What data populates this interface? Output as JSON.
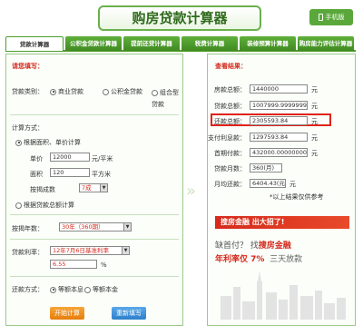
{
  "header": {
    "title": "购房贷款计算器",
    "mobile_label": "手机版"
  },
  "tabs": [
    {
      "label": "贷款计算器",
      "active": true
    },
    {
      "label": "公积金贷款计算器",
      "active": false
    },
    {
      "label": "提前还贷计算器",
      "active": false
    },
    {
      "label": "税费计算器",
      "active": false
    },
    {
      "label": "装修预算计算器",
      "active": false
    },
    {
      "label": "购房能力评估计算器",
      "active": false
    }
  ],
  "form": {
    "section_title": "请您填写：",
    "loan_type_label": "贷款类别：",
    "loan_types": [
      "商业贷款",
      "公积金贷款",
      "组合型贷款"
    ],
    "calc_method_label": "计算方式：",
    "method_by_price": "根据面积、单价计算",
    "unit_price_label": "单价",
    "unit_price_value": "12000",
    "unit_price_unit": "元/平米",
    "area_label": "面积",
    "area_value": "120",
    "area_unit": "平方米",
    "ratio_label": "按揭成数",
    "ratio_value": "7成",
    "method_by_total": "根据贷款总额计算",
    "years_label": "按揭年数：",
    "years_value": "30年（360期）",
    "rate_label": "贷款利率：",
    "rate_select": "12年7月6日基准利率",
    "rate_value": "6.55",
    "rate_unit": "%",
    "repay_label": "还款方式：",
    "repay_options": [
      "等额本息",
      "等额本金"
    ],
    "calc_button": "开始计算",
    "reset_button": "重新填写"
  },
  "results": {
    "section_title": "查看结果：",
    "rows": [
      {
        "label": "房款总额：",
        "value": "1440000",
        "unit": "元"
      },
      {
        "label": "贷款总额：",
        "value": "1007999.99999995",
        "unit": "元"
      },
      {
        "label": "还款总额：",
        "value": "2305593.84",
        "unit": "元"
      },
      {
        "label": "支付利息款：",
        "value": "1297593.84",
        "unit": "元"
      },
      {
        "label": "首期付款：",
        "value": "432000.000000000",
        "unit": "元"
      },
      {
        "label": "贷款月数：",
        "value": "360(月)",
        "unit": ""
      },
      {
        "label": "月均还款：",
        "value": "6404.43(元)",
        "unit": "元"
      }
    ],
    "note": "*以上结果仅供参考"
  },
  "promo": {
    "banner": "搜房金融  出大招了!",
    "line1_a": "缺首付？ 找",
    "line1_b": "搜房金融",
    "line2_a": "年利率仅 7%",
    "line2_b": "三天放款"
  },
  "colors": {
    "brand_green": "#4f9d2d",
    "highlight_red": "#e0231b"
  }
}
